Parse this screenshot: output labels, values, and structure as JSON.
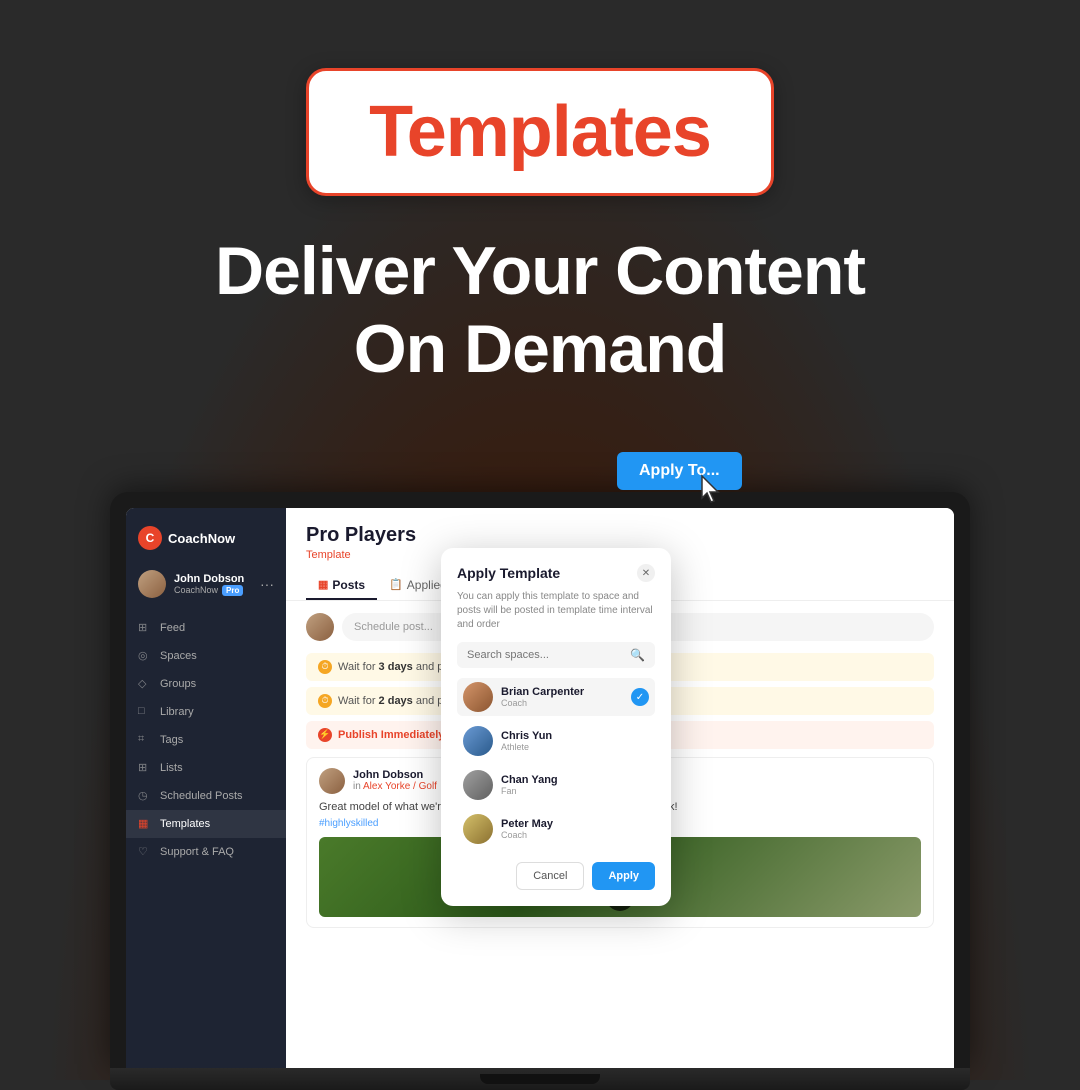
{
  "background": {
    "gradient": "radial dark"
  },
  "badge": {
    "text": "Templates",
    "border_color": "#e8442a",
    "text_color": "#e8442a"
  },
  "headline": {
    "line1": "Deliver Your Content",
    "line2": "On Demand"
  },
  "apply_to_button": {
    "label": "Apply To..."
  },
  "sidebar": {
    "brand": "CoachNow",
    "user_name": "John Dobson",
    "user_sub": "CoachNow",
    "pro_badge": "Pro",
    "nav_items": [
      {
        "label": "Feed",
        "icon": "feed"
      },
      {
        "label": "Spaces",
        "icon": "spaces"
      },
      {
        "label": "Groups",
        "icon": "groups"
      },
      {
        "label": "Library",
        "icon": "library"
      },
      {
        "label": "Tags",
        "icon": "tags"
      },
      {
        "label": "Lists",
        "icon": "lists"
      },
      {
        "label": "Scheduled Posts",
        "icon": "scheduled"
      },
      {
        "label": "Templates",
        "icon": "templates",
        "active": true
      },
      {
        "label": "Support & FAQ",
        "icon": "support"
      }
    ]
  },
  "main": {
    "title": "Pro Players",
    "subtitle": "Template",
    "tabs": [
      {
        "label": "Posts",
        "active": true
      },
      {
        "label": "Applied to",
        "active": false
      }
    ],
    "schedule_placeholder": "Schedule post...",
    "wait_items": [
      {
        "text": "Wait for ",
        "days": "3 days",
        "suffix": " and publish"
      },
      {
        "text": "Wait for ",
        "days": "2 days",
        "suffix": " and publish"
      }
    ],
    "publish_immediately": "Publish Immediately",
    "post": {
      "author": "John Dobson",
      "location": "Alex Yorke / Golf",
      "body": "Great model of what we're shooting for here. Let me know what you think!",
      "tag": "#highlyskilled"
    }
  },
  "modal": {
    "title": "Apply Template",
    "description": "You can apply this template to space and posts will be posted in template time interval and order",
    "search_placeholder": "Search spaces...",
    "users": [
      {
        "name": "Brian Carpenter",
        "role": "Coach",
        "selected": true,
        "avatar_class": "brian"
      },
      {
        "name": "Chris Yun",
        "role": "Athlete",
        "selected": false,
        "avatar_class": "chris"
      },
      {
        "name": "Chan Yang",
        "role": "Fan",
        "selected": false,
        "avatar_class": "chan"
      },
      {
        "name": "Peter May",
        "role": "Coach",
        "selected": false,
        "avatar_class": "peter"
      }
    ],
    "cancel_label": "Cancel",
    "apply_label": "Apply"
  }
}
